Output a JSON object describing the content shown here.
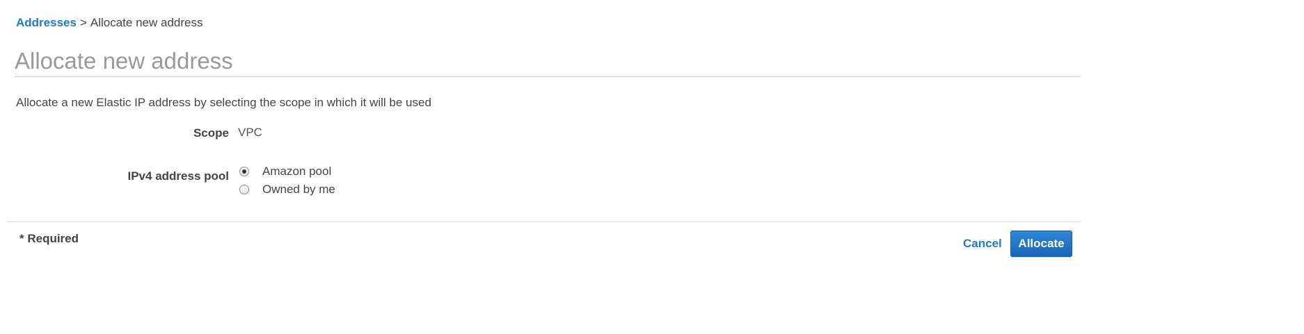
{
  "breadcrumb": {
    "parent": "Addresses",
    "separator": ">",
    "current": "Allocate new address"
  },
  "page": {
    "title": "Allocate new address",
    "description": "Allocate a new Elastic IP address by selecting the scope in which it will be used"
  },
  "form": {
    "scope": {
      "label": "Scope",
      "value": "VPC"
    },
    "ipv4_pool": {
      "label": "IPv4 address pool",
      "options": [
        {
          "label": "Amazon pool",
          "selected": true
        },
        {
          "label": "Owned by me",
          "selected": false
        }
      ]
    }
  },
  "footer": {
    "required_note": "* Required",
    "cancel_label": "Cancel",
    "allocate_label": "Allocate"
  },
  "colors": {
    "link": "#1f7acc",
    "primary_button": "#1a66b8",
    "title": "#999999",
    "text": "#444444"
  }
}
